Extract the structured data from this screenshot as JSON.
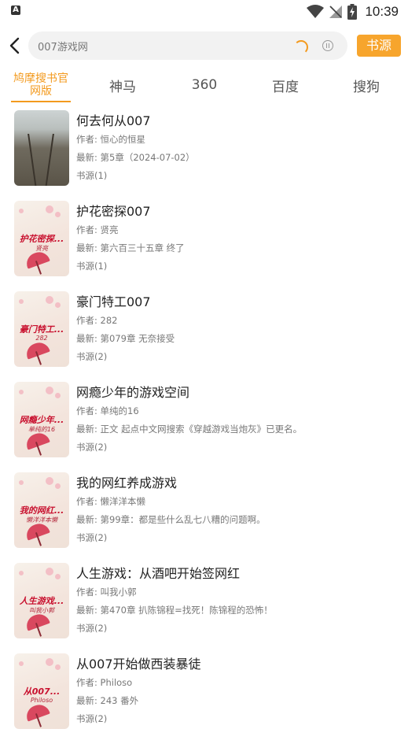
{
  "status_bar": {
    "time": "10:39",
    "left_icon": "A"
  },
  "search": {
    "query": "007游戏网",
    "source_button": "书源"
  },
  "tabs": [
    {
      "label": "鸠摩搜书官网版",
      "line1": "鸠摩搜书官",
      "line2": "网版",
      "active": true
    },
    {
      "label": "神马",
      "active": false
    },
    {
      "label": "360",
      "active": false
    },
    {
      "label": "百度",
      "active": false
    },
    {
      "label": "搜狗",
      "active": false
    }
  ],
  "results": [
    {
      "title": "何去何从007",
      "author": "作者: 恒心的恒星",
      "latest": "最新: 第5章（2024-07-02）",
      "source": "书源(1)",
      "cover": "railway-photo",
      "cover_title": "",
      "cover_author": ""
    },
    {
      "title": "护花密探007",
      "author": "作者: 贤亮",
      "latest": "最新: 第六百三十五章 终了",
      "source": "书源(1)",
      "cover": "blossom-umbrella",
      "cover_title": "护花密探...",
      "cover_author": "贤亮"
    },
    {
      "title": "豪门特工007",
      "author": "作者: 282",
      "latest": "最新: 第079章 无奈接受",
      "source": "书源(2)",
      "cover": "blossom-umbrella",
      "cover_title": "豪门特工...",
      "cover_author": "282"
    },
    {
      "title": "网瘾少年的游戏空间",
      "author": "作者: 单纯的16",
      "latest": "最新: 正文 起点中文网搜索《穿越游戏当炮灰》已更名。",
      "source": "书源(2)",
      "cover": "blossom-umbrella",
      "cover_title": "网瘾少年...",
      "cover_author": "单纯的16"
    },
    {
      "title": "我的网红养成游戏",
      "author": "作者: 懒洋洋本懒",
      "latest": "最新: 第99章：都是些什么乱七八糟的问题啊。",
      "source": "书源(2)",
      "cover": "blossom-umbrella",
      "cover_title": "我的网红...",
      "cover_author": "懒洋洋本懒"
    },
    {
      "title": "人生游戏：从酒吧开始签网红",
      "author": "作者: 叫我小郭",
      "latest": "最新: 第470章 扒陈锦程=找死！陈锦程的恐怖！",
      "source": "书源(2)",
      "cover": "blossom-umbrella",
      "cover_title": "人生游戏...",
      "cover_author": "叫我小郭"
    },
    {
      "title": "从007开始做西装暴徒",
      "author": "作者: Philoso",
      "latest": "最新: 243 番外",
      "source": "书源(2)",
      "cover": "blossom-umbrella",
      "cover_title": "从007...",
      "cover_author": "Philoso"
    }
  ],
  "colors": {
    "accent": "#f39a1e",
    "button": "#f7a52d",
    "cover_text": "#c8102e"
  }
}
